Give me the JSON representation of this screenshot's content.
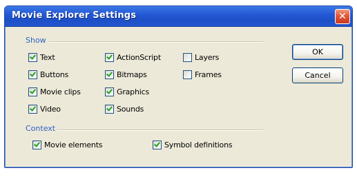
{
  "window": {
    "title": "Movie Explorer Settings",
    "close_glyph": "✕"
  },
  "show": {
    "label": "Show",
    "items": [
      {
        "label": "Text",
        "checked": true
      },
      {
        "label": "Buttons",
        "checked": true
      },
      {
        "label": "Movie clips",
        "checked": true
      },
      {
        "label": "Video",
        "checked": true
      },
      {
        "label": "ActionScript",
        "checked": true
      },
      {
        "label": "Bitmaps",
        "checked": true
      },
      {
        "label": "Graphics",
        "checked": true
      },
      {
        "label": "Sounds",
        "checked": true
      },
      {
        "label": "Layers",
        "checked": false
      },
      {
        "label": "Frames",
        "checked": false
      }
    ]
  },
  "context": {
    "label": "Context",
    "items": [
      {
        "label": "Movie elements",
        "checked": true
      },
      {
        "label": "Symbol definitions",
        "checked": true
      }
    ]
  },
  "buttons": {
    "ok_label": "OK",
    "cancel_label": "Cancel"
  },
  "colors": {
    "titlebar": "#2559d6",
    "dialog_bg": "#ece9d8",
    "section_label": "#2d62c9",
    "checkmark": "#21a121",
    "close_button": "#e2583a"
  },
  "icons": {
    "close": "close-icon",
    "check": "checkmark-icon"
  }
}
